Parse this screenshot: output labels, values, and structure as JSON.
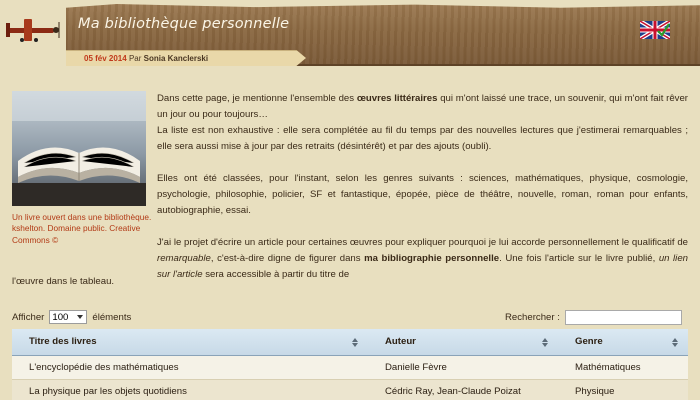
{
  "header": {
    "site_title": "Ma bibliothèque personnelle",
    "date": "05 fév 2014",
    "by_text": "Par",
    "author": "Sonia Kanclerski",
    "language_flag": "uk-flag-icon"
  },
  "sidebar": {
    "image_alt": "open-book-photo",
    "caption_line1": "Un livre ouvert dans une bibliothèque.",
    "caption_line2": "kshelton. Domaine public. Creative Commons ©"
  },
  "article": {
    "p1_a": "Dans cette page, je mentionne l'ensemble des ",
    "p1_bold": "œuvres littéraires",
    "p1_b": " qui m'ont laissé une trace, un souvenir, qui m'ont fait rêver un jour ou pour toujours…",
    "p2": "La liste est non exhaustive : elle sera complétée au fil du temps par des nouvelles lectures que j'estimerai remarquables ; elle sera aussi mise à jour par des retraits (désintérêt) et par des ajouts (oubli).",
    "p3": "Elles ont été classées, pour l'instant, selon les genres suivants : sciences, mathématiques, physique, cosmologie, psychologie, philosophie, policier, SF et fantastique, épopée, pièce de théâtre, nouvelle, roman, roman pour enfants, autobiographie, essai.",
    "p4_a": "J'ai le projet d'écrire un article pour certaines œuvres pour expliquer pourquoi je lui accorde personnellement le qualificatif de ",
    "p4_italic": "remarquable",
    "p4_b": ", c'est-à-dire digne de figurer dans ",
    "p4_bold": "ma bibliographie personnelle",
    "p4_c": ". Une fois l'article sur le livre publié, ",
    "p4_italic2": "un lien sur l'article",
    "p4_d": " sera accessible à partir du titre de",
    "p4_tail": "l'œuvre dans le tableau."
  },
  "controls": {
    "show_label": "Afficher",
    "page_size": "100",
    "entries_label": "éléments",
    "search_label": "Rechercher :",
    "search_value": ""
  },
  "table": {
    "columns": [
      "Titre des livres",
      "Auteur",
      "Genre"
    ],
    "rows": [
      [
        "L'encyclopédie des mathématiques",
        "Danielle Fèvre",
        "Mathématiques"
      ],
      [
        "La physique par les objets quotidiens",
        "Cédric Ray, Jean-Claude Poizat",
        "Physique"
      ]
    ]
  }
}
